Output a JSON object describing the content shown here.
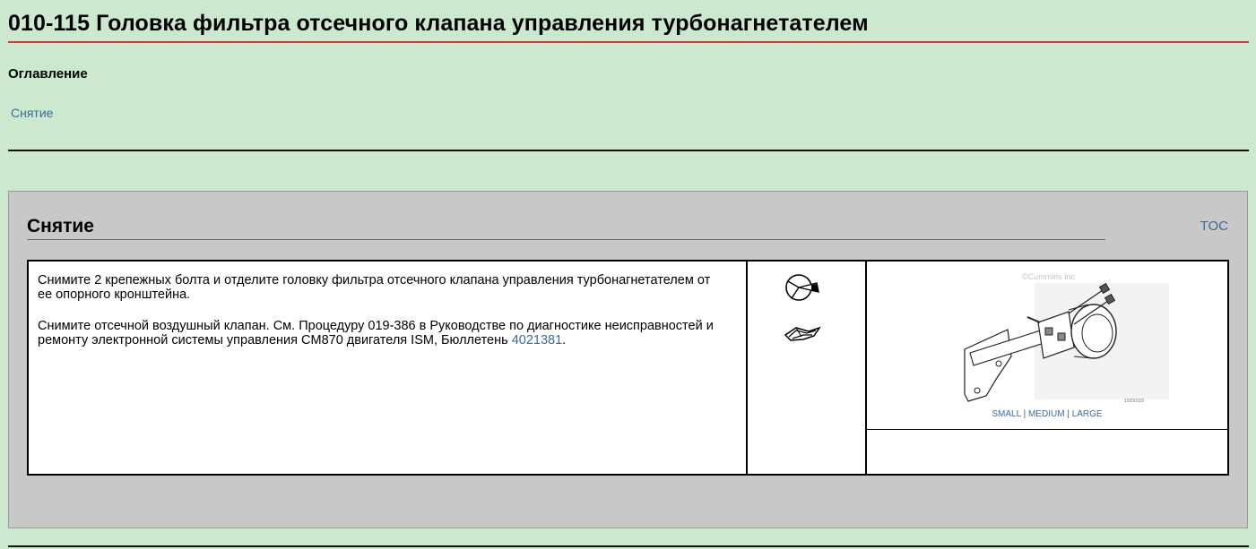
{
  "header": {
    "title": "010-115 Головка фильтра отсечного клапана управления турбонагнетателем"
  },
  "toc": {
    "heading": "Оглавление",
    "items": [
      "Снятие"
    ]
  },
  "section": {
    "title": "Снятие",
    "toc_link": "TOC",
    "paragraph1": "Снимите 2 крепежных болта и отделите головку фильтра отсечного клапана управления турбонагнетателем от ее опорного кронштейна.",
    "paragraph2_text": "Снимите отсечной воздушный клапан. См. Процедуру 019-386 в Руководстве по диагностике неисправностей и ремонту электронной системы управления CM870 двигателя ISM, Бюллетень ",
    "paragraph2_link": "4021381",
    "paragraph2_end": ".",
    "icons": [
      "remove-icon",
      "manual-icon"
    ],
    "figure": {
      "watermark": "©Cummins Inc",
      "figure_id": "10200118",
      "sizes": [
        "SMALL",
        "MEDIUM",
        "LARGE"
      ],
      "separator": "|"
    }
  }
}
